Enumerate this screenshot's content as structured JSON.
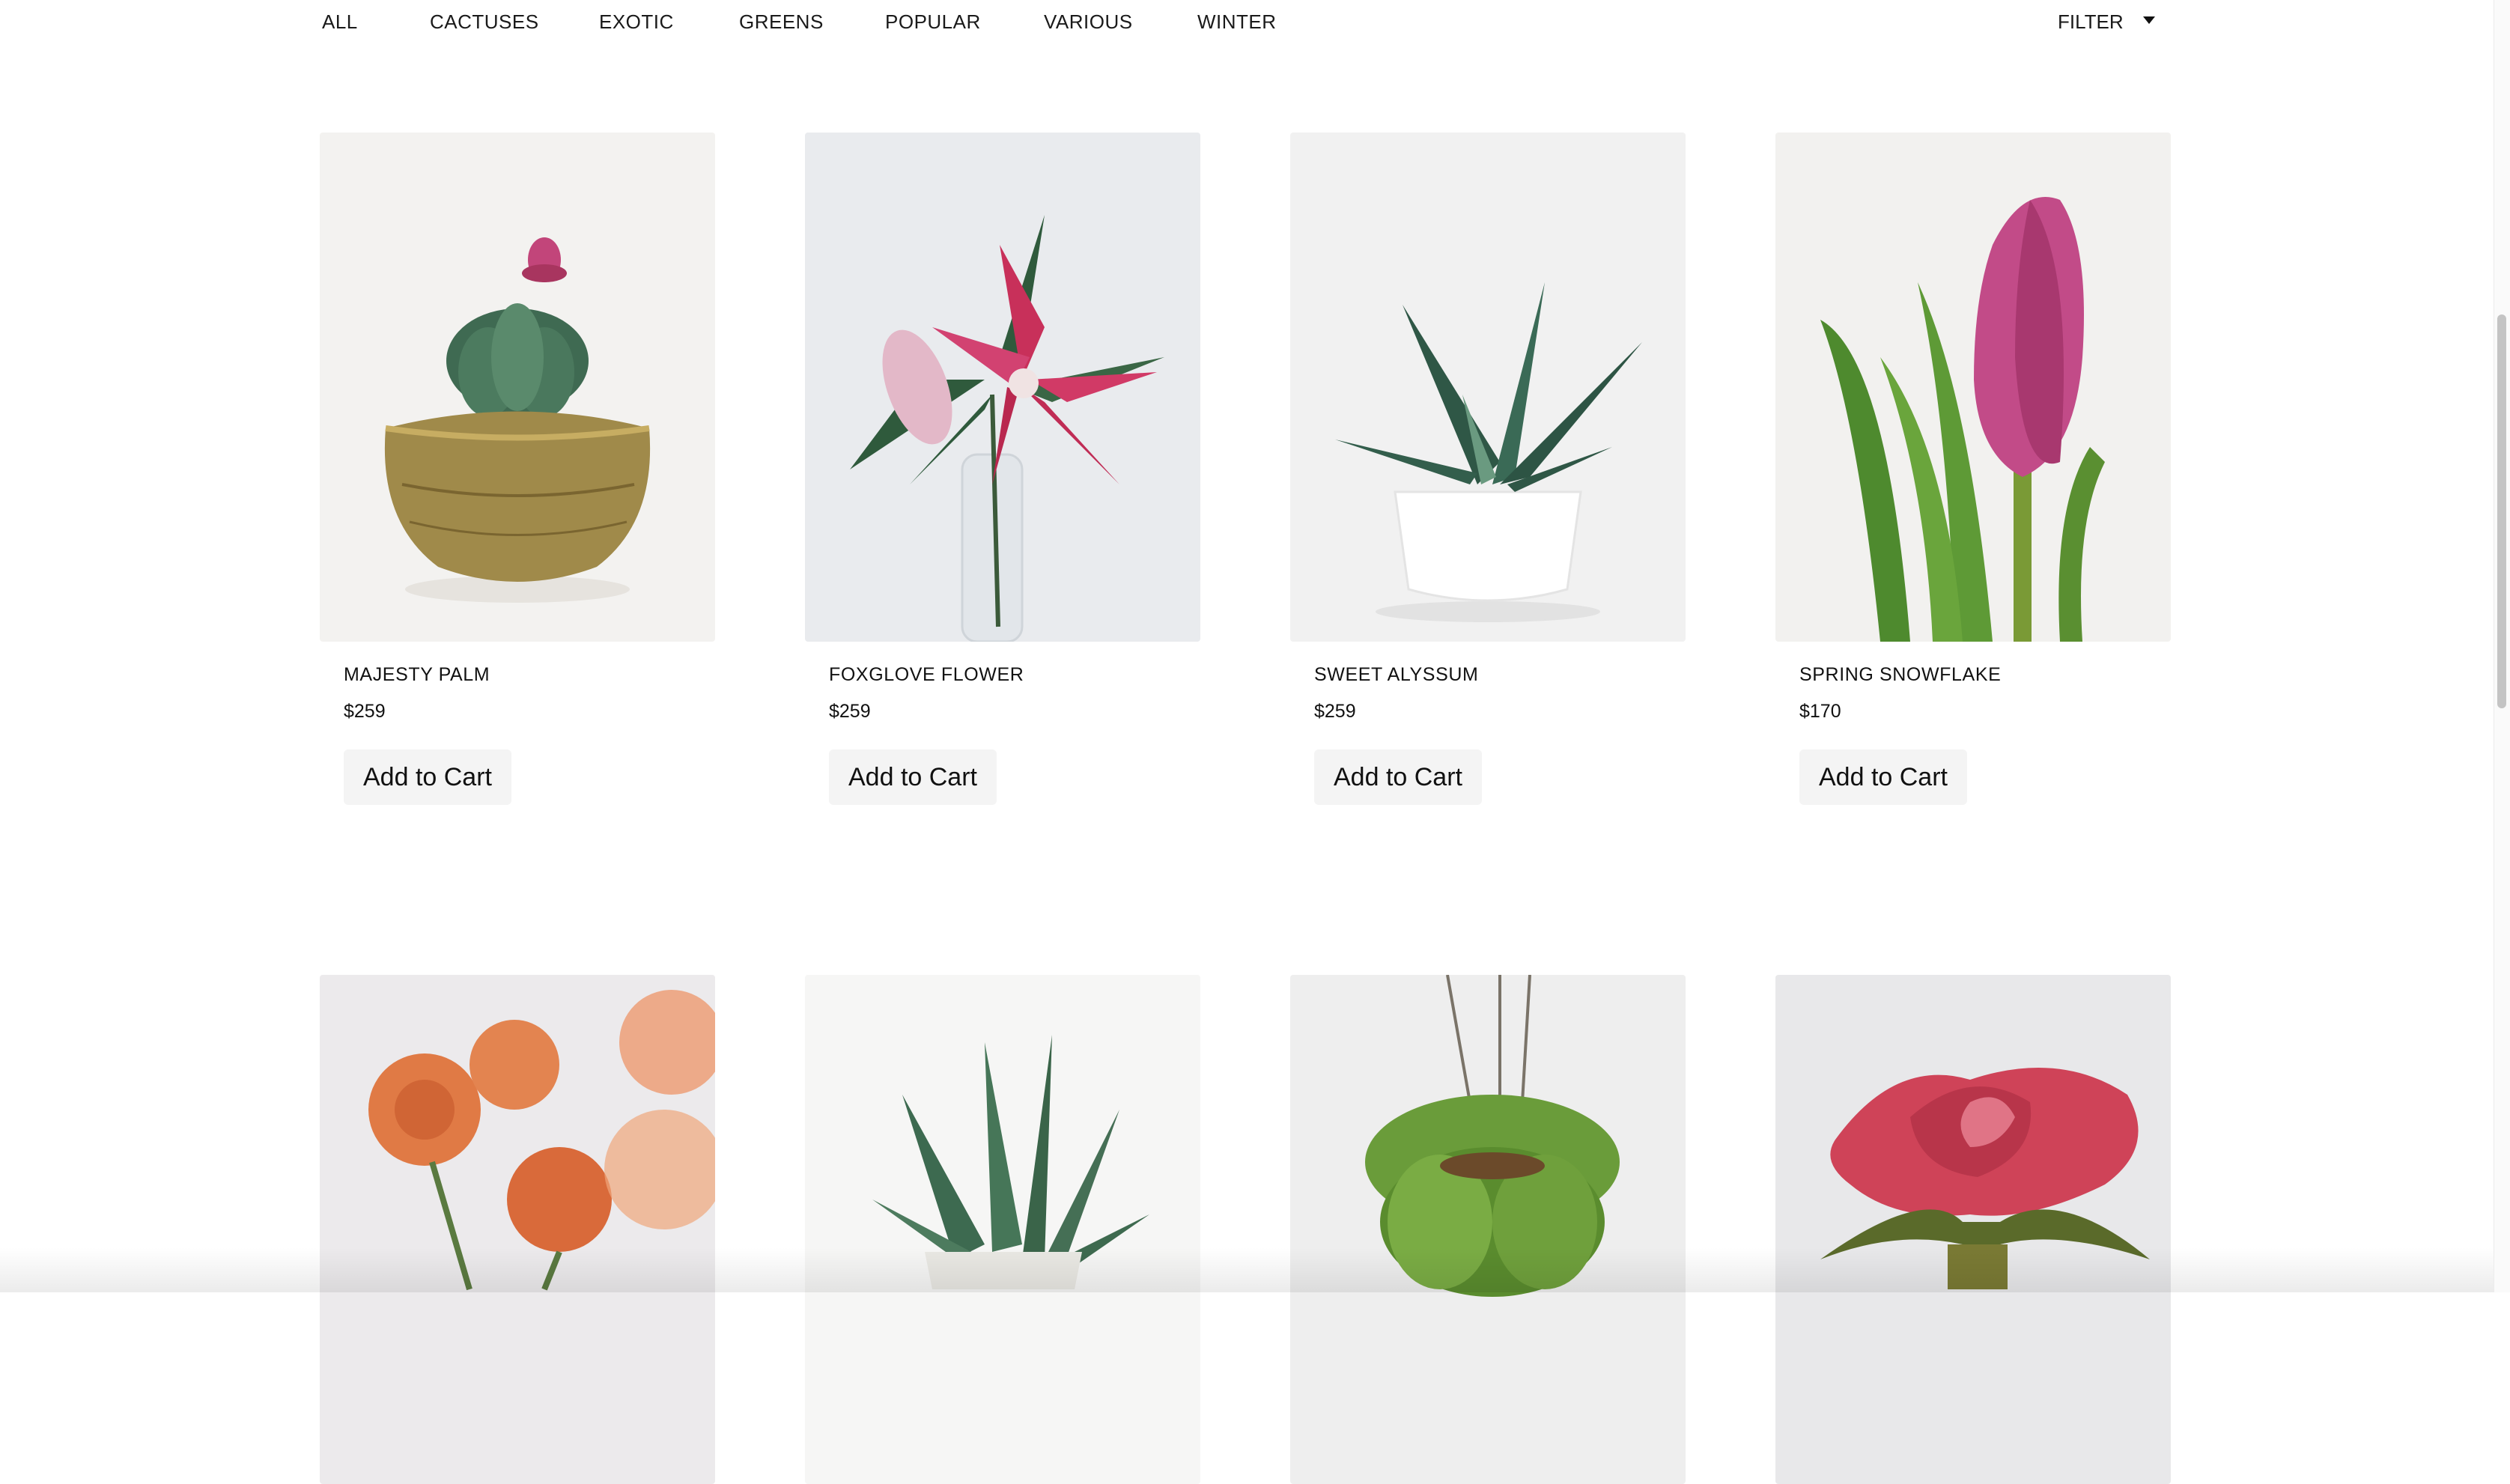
{
  "nav": {
    "categories": [
      "ALL",
      "CACTUSES",
      "EXOTIC",
      "GREENS",
      "POPULAR",
      "VARIOUS",
      "WINTER"
    ],
    "filter_label": "FILTER"
  },
  "products": [
    {
      "name": "MAJESTY PALM",
      "price": "$259",
      "button": "Add to Cart",
      "icon": "potted-cactus-image"
    },
    {
      "name": "FOXGLOVE FLOWER",
      "price": "$259",
      "button": "Add to Cart",
      "icon": "lily-flower-image"
    },
    {
      "name": "SWEET ALYSSUM",
      "price": "$259",
      "button": "Add to Cart",
      "icon": "succulent-pot-image"
    },
    {
      "name": "SPRING SNOWFLAKE",
      "price": "$170",
      "button": "Add to Cart",
      "icon": "tulip-image"
    }
  ],
  "second_row": [
    {
      "icon": "orange-roses-image"
    },
    {
      "icon": "aloe-plant-image"
    },
    {
      "icon": "hanging-plant-image"
    },
    {
      "icon": "red-rose-image"
    }
  ]
}
